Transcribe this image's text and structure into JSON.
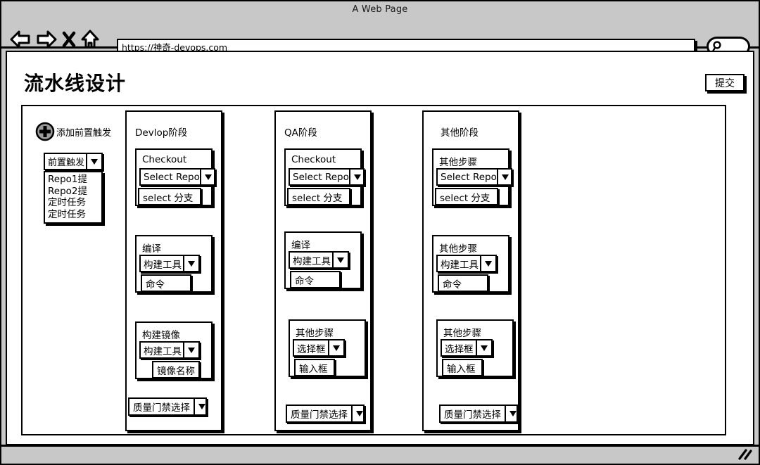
{
  "browser": {
    "window_title": "A Web Page",
    "url": "https://神奇-devops.com",
    "nav_icons": [
      "back-arrow-icon",
      "forward-arrow-icon",
      "close-icon",
      "home-icon"
    ],
    "search_icon": "search-icon",
    "resize_grip": "resize-grip-icon"
  },
  "page": {
    "title": "流水线设计",
    "submit_label": "提交"
  },
  "trigger_panel": {
    "add_icon": "plus-circle-icon",
    "add_label": "添加前置触发",
    "select_value": "前置触发",
    "dropdown_icon": "chevron-down-icon",
    "options": [
      "Repo1提",
      "Repo2提",
      "定时任务",
      "定时任务"
    ]
  },
  "stages": [
    {
      "title": "Devlop阶段",
      "steps": [
        {
          "title": "Checkout",
          "select_value": "Select Repo",
          "input_value": "select 分支"
        },
        {
          "title": "编译",
          "select_value": "构建工具",
          "input_value": "命令"
        },
        {
          "title": "构建镜像",
          "select_value": "构建工具",
          "input_value": "镜像名称"
        }
      ],
      "gate_label": "质量门禁选择"
    },
    {
      "title": "QA阶段",
      "steps": [
        {
          "title": "Checkout",
          "select_value": "Select Repo",
          "input_value": "select 分支"
        },
        {
          "title": "编译",
          "select_value": "构建工具",
          "input_value": "命令"
        },
        {
          "title": "其他步骤",
          "select_value": "选择框",
          "input_value": "输入框"
        }
      ],
      "gate_label": "质量门禁选择"
    },
    {
      "title": "其他阶段",
      "steps": [
        {
          "title": "其他步骤",
          "select_value": "Select Repo",
          "input_value": "select 分支"
        },
        {
          "title": "其他步骤",
          "select_value": "构建工具",
          "input_value": "命令"
        },
        {
          "title": "其他步骤",
          "select_value": "选择框",
          "input_value": "输入框"
        }
      ],
      "gate_label": "质量门禁选择"
    }
  ],
  "colors": {
    "chrome": "#c8c8c8",
    "canvas": "#ffffff",
    "line": "#000000",
    "icon_fill": "#999999"
  }
}
